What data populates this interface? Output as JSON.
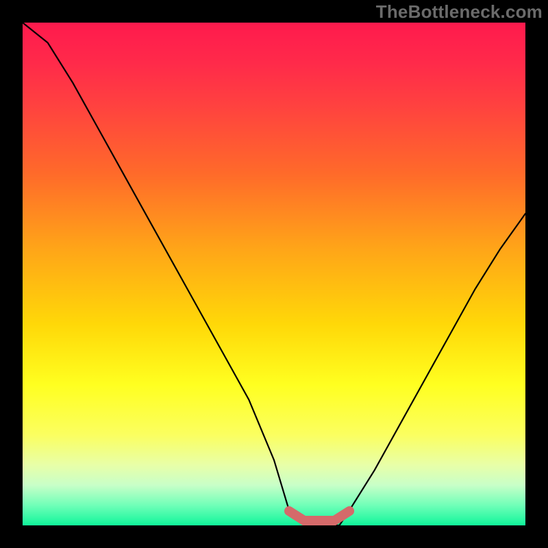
{
  "watermark": "TheBottleneck.com",
  "colors": {
    "background": "#000000",
    "curve_stroke": "#000000",
    "flat_marker": "#d56a6a",
    "gradient_top": "#ff1a4d",
    "gradient_bottom": "#10f59a"
  },
  "chart_data": {
    "type": "line",
    "title": "",
    "xlabel": "",
    "ylabel": "",
    "xlim": [
      0,
      100
    ],
    "ylim": [
      0,
      100
    ],
    "grid": false,
    "series": [
      {
        "name": "bottleneck-curve",
        "x": [
          0,
          5,
          10,
          15,
          20,
          25,
          30,
          35,
          40,
          45,
          50,
          53,
          58,
          63,
          65,
          70,
          75,
          80,
          85,
          90,
          95,
          100
        ],
        "values": [
          100,
          96,
          88,
          79,
          70,
          61,
          52,
          43,
          34,
          25,
          13,
          3,
          0,
          0,
          3,
          11,
          20,
          29,
          38,
          47,
          55,
          62
        ]
      }
    ],
    "annotations": [
      {
        "name": "optimal-flat-region",
        "x_start": 53,
        "x_end": 65,
        "y": 0,
        "note": "thick pink marker along valley floor"
      }
    ]
  }
}
